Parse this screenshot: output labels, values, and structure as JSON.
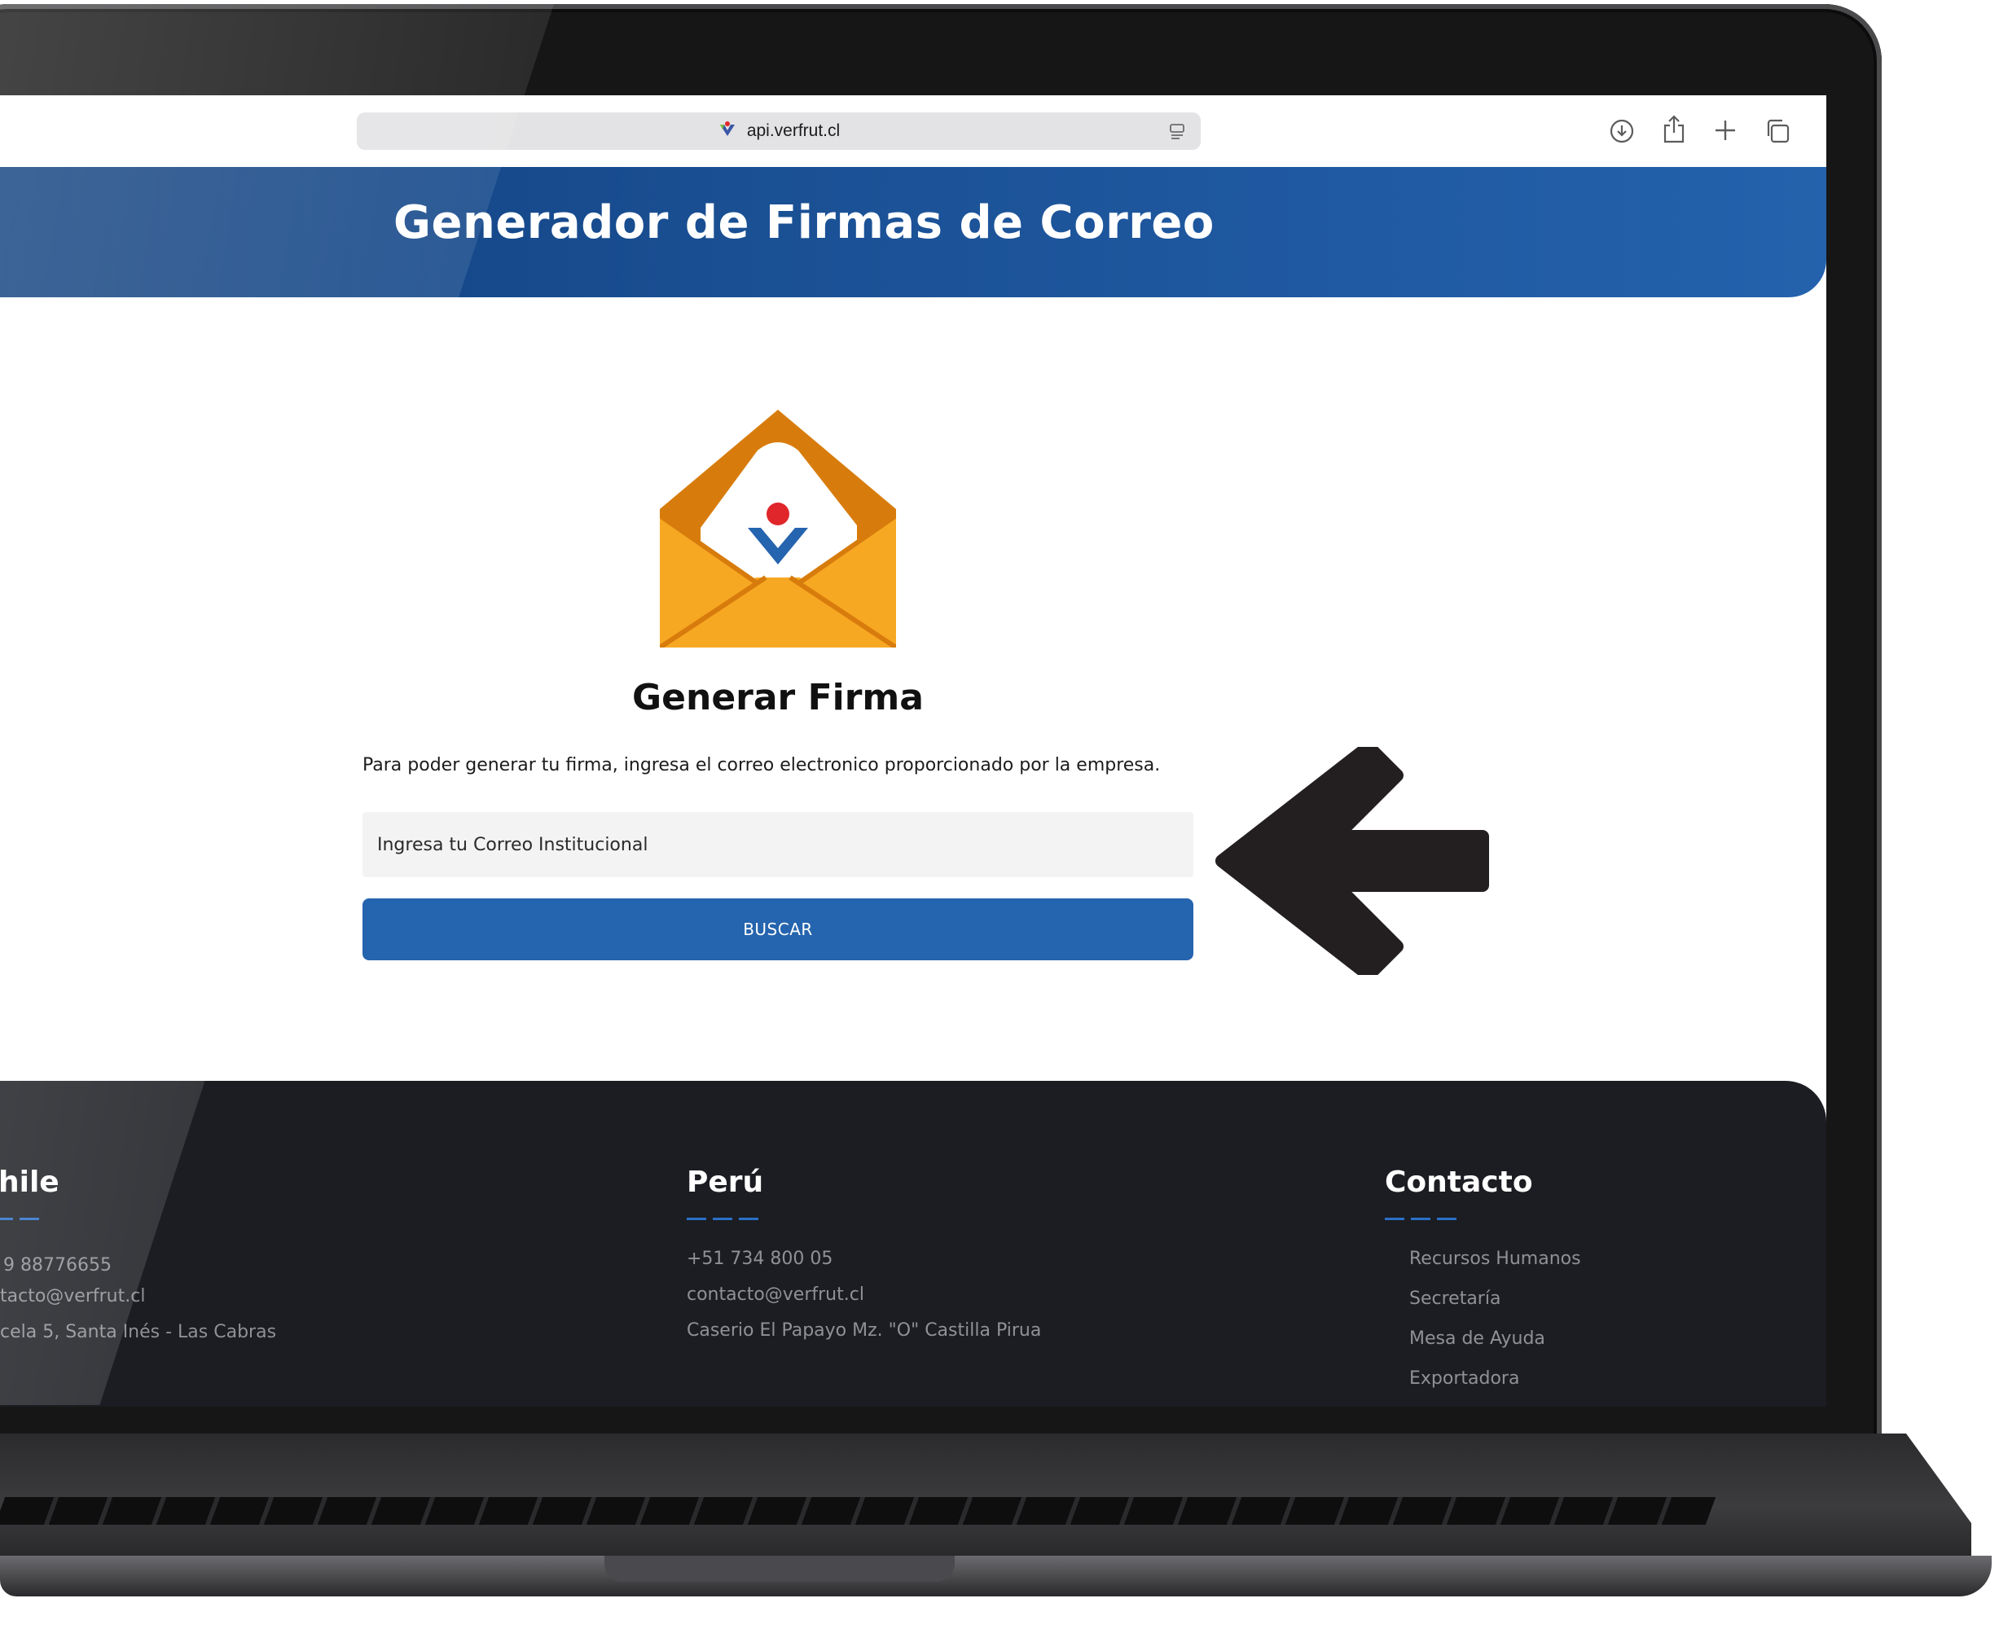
{
  "browser": {
    "url": "api.verfrut.cl",
    "icons": [
      "verfrut-favicon-icon",
      "reader-icon",
      "download-icon",
      "share-icon",
      "new-tab-icon",
      "tabs-icon"
    ]
  },
  "header": {
    "title": "Generador de Firmas de Correo"
  },
  "main": {
    "envelope_icon": "envelope-logo-icon",
    "section_title": "Generar Firma",
    "instructions": "Para poder generar tu firma, ingresa el correo electronico proporcionado por la empresa.",
    "email_placeholder": "Ingresa tu Correo Institucional",
    "button_label": "BUSCAR",
    "arrow_icon": "arrow-left-icon"
  },
  "footer": {
    "chile": {
      "heading": "hile",
      "lines": [
        "9 88776655",
        "tacto@verfrut.cl",
        "cela 5, Santa Inés - Las Cabras"
      ]
    },
    "peru": {
      "heading": "Perú",
      "lines": [
        "+51 734 800 05",
        "contacto@verfrut.cl",
        "Caserio El Papayo Mz. \"O\" Castilla Pirua"
      ]
    },
    "contacto": {
      "heading": "Contacto",
      "links": [
        "Recursos Humanos",
        "Secretaría",
        "Mesa de Ayuda",
        "Exportadora"
      ]
    }
  },
  "colors": {
    "header_blue": "#1a4f93",
    "button_blue": "#2564ae",
    "footer_bg": "#1b1d22",
    "envelope_orange": "#f7a823",
    "logo_red": "#e0262a"
  }
}
